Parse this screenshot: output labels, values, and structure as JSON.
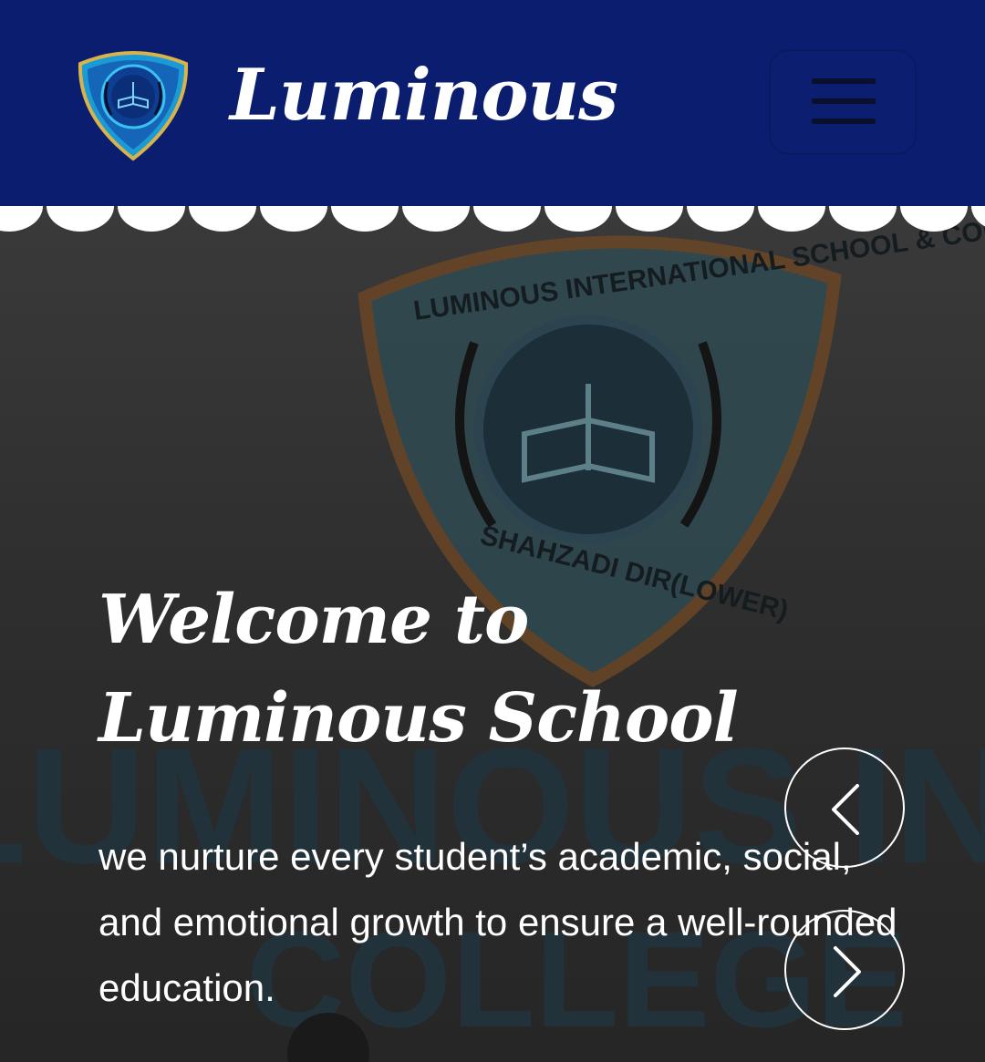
{
  "header": {
    "brand": "Luminous",
    "logo_ring_text": "LUMINOUS INTERNATIONAL SCHOOL & COLLEGE",
    "menu_icon": "hamburger-menu-icon"
  },
  "hero": {
    "title": "Welcome to Luminous School",
    "description": "we nurture every student’s academic, social, and emotional growth to ensure a well-rounded education.",
    "prev_icon": "chevron-left-icon",
    "next_icon": "chevron-right-icon",
    "background": {
      "emblem_top_text": "LUMINOUS INTERNATIONAL SCHOOL & COLLEGE",
      "emblem_bottom_text": "SHAHZADI DIR(LOWER)",
      "banner_text": "LUMINOUS INTERNATIONAL",
      "banner_sub_text": "COLLEGE"
    }
  },
  "colors": {
    "header_bg": "#0b1d6e",
    "hero_overlay": "#2a2a2c",
    "text": "#ffffff",
    "emblem_blue": "#1f6f8b",
    "emblem_gold": "#b0662a"
  }
}
